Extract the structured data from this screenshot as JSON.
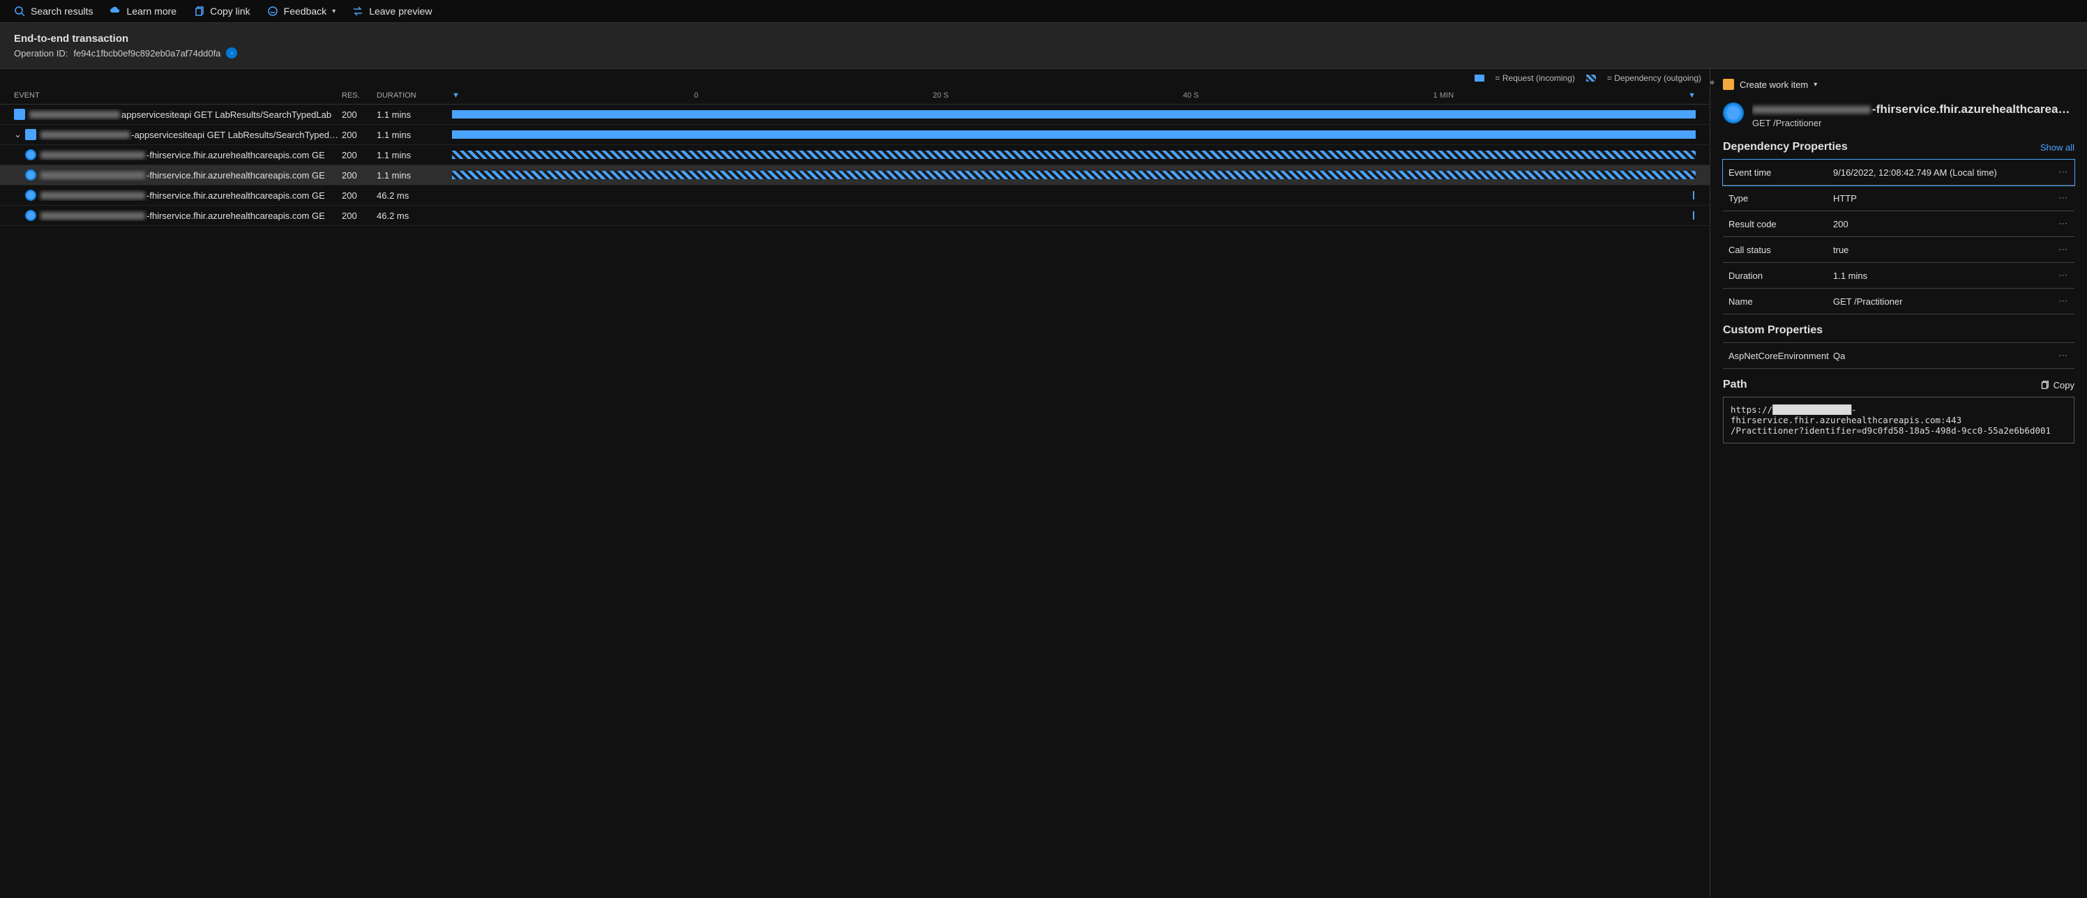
{
  "toolbar": {
    "search": "Search results",
    "learn": "Learn more",
    "copy": "Copy link",
    "feedback": "Feedback",
    "leave": "Leave preview"
  },
  "header": {
    "title": "End-to-end transaction",
    "op_label": "Operation ID:",
    "op_id": "fe94c1fbcb0ef9c892eb0a7af74dd0fa"
  },
  "legend": {
    "request": "= Request (incoming)",
    "dependency": "= Dependency (outgoing)"
  },
  "columns": {
    "event": "Event",
    "res": "Res.",
    "duration": "Duration"
  },
  "ticks": [
    "0",
    "20 S",
    "40 S",
    "1 MIN"
  ],
  "rows": [
    {
      "indent": 0,
      "iconType": "blue",
      "redactW": 130,
      "suffix": "appservicesiteapi",
      "op": "GET LabResults/SearchTypedLab",
      "res": "200",
      "dur": "1.1 mins",
      "barType": "solid",
      "barW": 100,
      "expander": ""
    },
    {
      "indent": 0,
      "iconType": "blue",
      "redactW": 130,
      "suffix": "-appservicesiteapi",
      "op": "GET LabResults/SearchTypedLab",
      "res": "200",
      "dur": "1.1 mins",
      "barType": "solid",
      "barW": 100,
      "expander": "v"
    },
    {
      "indent": 1,
      "iconType": "globe",
      "redactW": 150,
      "suffix": "-fhirservice.fhir.azurehealthcareapis.com",
      "op": "GE",
      "res": "200",
      "dur": "1.1 mins",
      "barType": "hatched",
      "barW": 100,
      "expander": ""
    },
    {
      "indent": 1,
      "iconType": "globe",
      "redactW": 150,
      "suffix": "-fhirservice.fhir.azurehealthcareapis.com",
      "op": "GE",
      "res": "200",
      "dur": "1.1 mins",
      "barType": "hatched",
      "barW": 100,
      "expander": "",
      "selected": true
    },
    {
      "indent": 1,
      "iconType": "globe",
      "redactW": 150,
      "suffix": "-fhirservice.fhir.azurehealthcareapis.com",
      "op": "GE",
      "res": "200",
      "dur": "46.2 ms",
      "barType": "tiny",
      "barW": 1,
      "expander": ""
    },
    {
      "indent": 1,
      "iconType": "globe",
      "redactW": 150,
      "suffix": "-fhirservice.fhir.azurehealthcareapis.com",
      "op": "GE",
      "res": "200",
      "dur": "46.2 ms",
      "barType": "tiny",
      "barW": 1,
      "expander": ""
    }
  ],
  "right": {
    "create_work_item": "Create work item",
    "title_suffix": "-fhirservice.fhir.azurehealthcareapi...",
    "subtitle": "GET /Practitioner",
    "dep_props_title": "Dependency Properties",
    "show_all": "Show all",
    "props": [
      {
        "k": "Event time",
        "v": "9/16/2022, 12:08:42.749 AM (Local time)",
        "hl": true
      },
      {
        "k": "Type",
        "v": "HTTP"
      },
      {
        "k": "Result code",
        "v": "200"
      },
      {
        "k": "Call status",
        "v": "true"
      },
      {
        "k": "Duration",
        "v": "1.1 mins"
      },
      {
        "k": "Name",
        "v": "GET /Practitioner"
      }
    ],
    "custom_title": "Custom Properties",
    "custom_props": [
      {
        "k": "AspNetCoreEnvironment",
        "v": "Qa"
      }
    ],
    "path_title": "Path",
    "copy_label": "Copy",
    "path_value": "https://███████████████-\nfhirservice.fhir.azurehealthcareapis.com:443\n/Practitioner?identifier=d9c0fd58-18a5-498d-9cc0-55a2e6b6d001"
  }
}
